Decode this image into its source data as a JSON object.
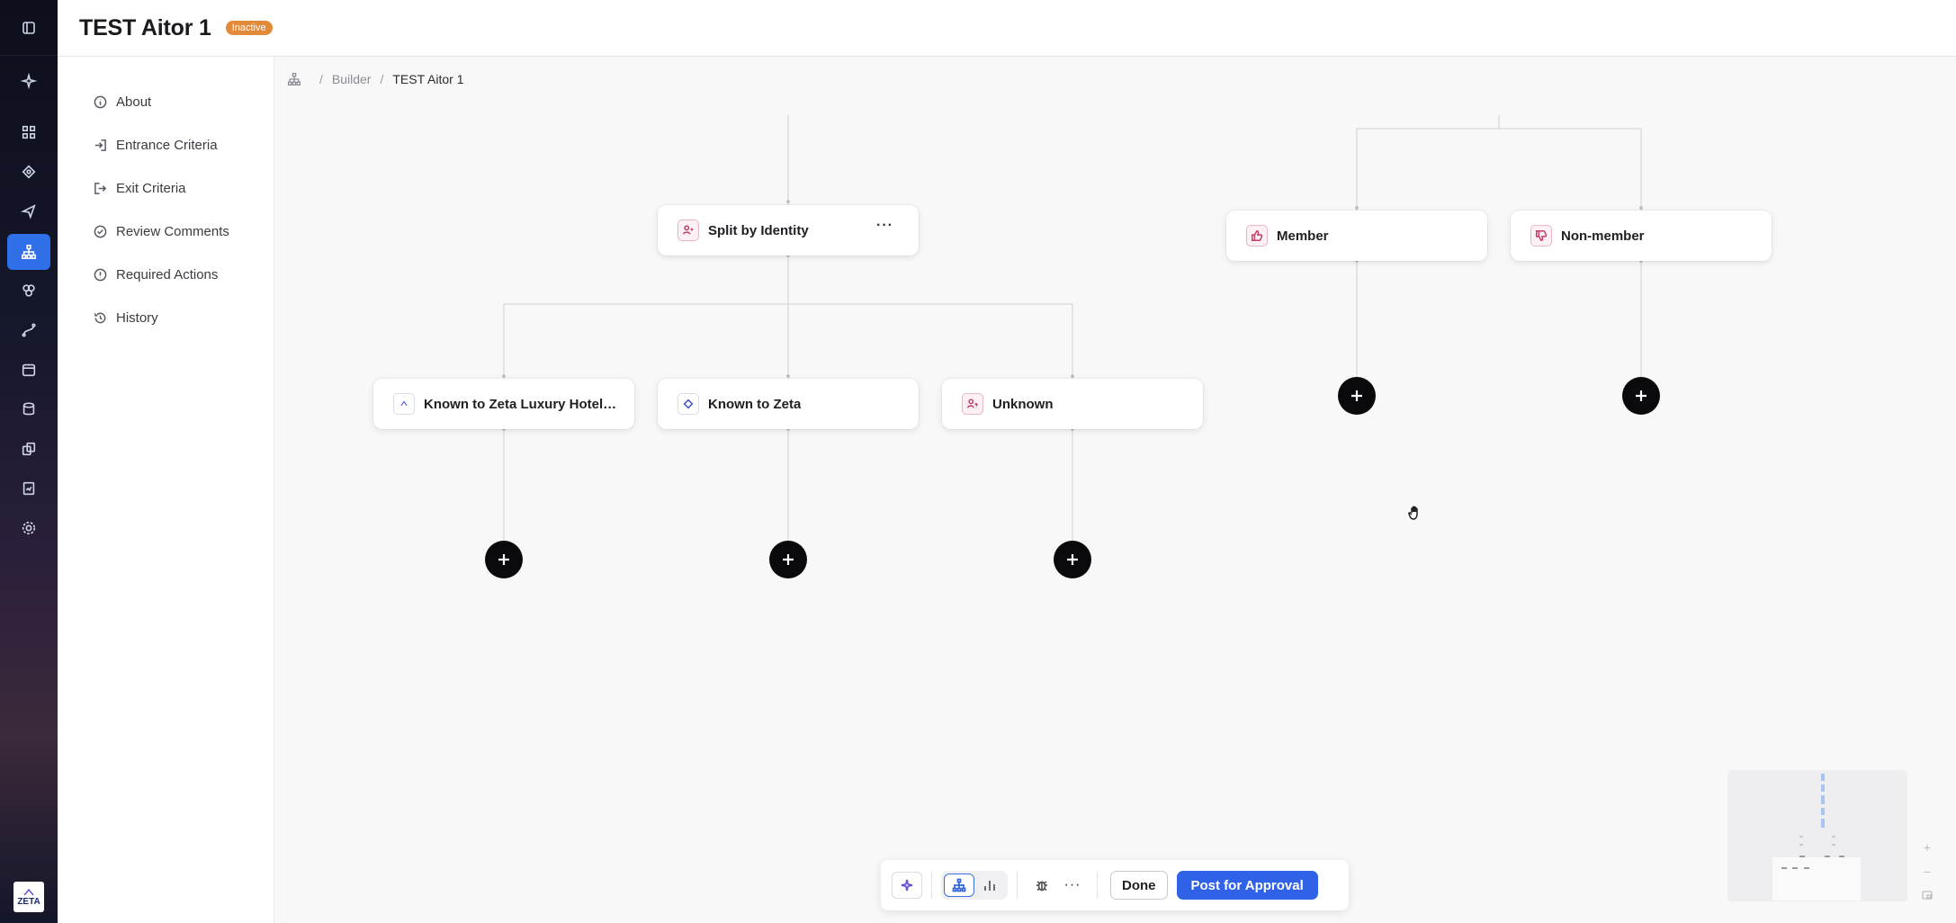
{
  "header": {
    "title": "TEST Aitor 1",
    "status": "Inactive"
  },
  "rail": {
    "top_icon": "sidebar-toggle-icon",
    "icons": [
      "sparkle-icon",
      "dashboard-icon",
      "target-icon",
      "send-icon",
      "journey-icon",
      "segments-icon",
      "routing-icon",
      "calendar-icon",
      "database-icon",
      "assets-icon",
      "reports-icon",
      "settings-icon"
    ],
    "active_icon": "journey-icon",
    "logo": "ZETA"
  },
  "sidenav": {
    "items": [
      {
        "label": "About",
        "icon": "info-icon"
      },
      {
        "label": "Entrance Criteria",
        "icon": "login-icon"
      },
      {
        "label": "Exit Criteria",
        "icon": "logout-icon"
      },
      {
        "label": "Review Comments",
        "icon": "check-circle-icon"
      },
      {
        "label": "Required Actions",
        "icon": "alert-circle-icon"
      },
      {
        "label": "History",
        "icon": "history-icon"
      }
    ]
  },
  "breadcrumb": {
    "root_icon": "journey-icon",
    "items": [
      "Builder",
      "TEST Aitor 1"
    ]
  },
  "canvas": {
    "nodes": {
      "split": {
        "label": "Split by Identity",
        "more": "···",
        "icon": "user-split-icon"
      },
      "known_hotel": {
        "label": "Known to Zeta Luxury Hotel Collection",
        "icon": "zeta-icon"
      },
      "known_zeta": {
        "label": "Known to Zeta",
        "icon": "zeta-diamond-icon"
      },
      "unknown": {
        "label": "Unknown",
        "icon": "user-question-icon"
      },
      "member": {
        "label": "Member",
        "icon": "thumbs-up-icon"
      },
      "non_member": {
        "label": "Non-member",
        "icon": "thumbs-down-icon"
      }
    },
    "add_buttons": 5
  },
  "toolbar": {
    "done_label": "Done",
    "approval_label": "Post for Approval",
    "more_label": "···"
  },
  "colors": {
    "accent": "#2f62e6",
    "badge": "#e38a3a",
    "rail_active": "#2f6fe8"
  }
}
